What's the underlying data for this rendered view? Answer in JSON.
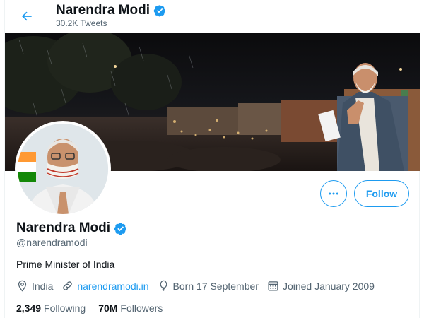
{
  "header": {
    "name": "Narendra Modi",
    "tweet_count": "30.2K Tweets"
  },
  "profile": {
    "name": "Narendra Modi",
    "handle": "@narendramodi",
    "bio": "Prime Minister of India",
    "location": "India",
    "website": "narendramodi.in",
    "birthday": "Born 17 September",
    "joined": "Joined January 2009",
    "following_count": "2,349",
    "following_label": "Following",
    "followers_count": "70M",
    "followers_label": "Followers"
  },
  "actions": {
    "follow_label": "Follow"
  },
  "colors": {
    "accent": "#1d9bf0",
    "text": "#0f1419",
    "muted": "#536471"
  }
}
